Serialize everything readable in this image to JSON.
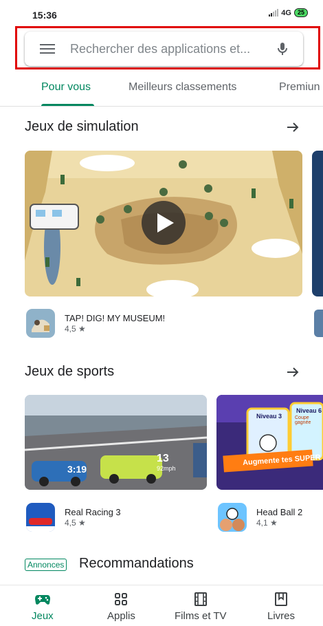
{
  "status_bar": {
    "time": "15:36",
    "network": "4G",
    "battery": "25"
  },
  "search": {
    "placeholder": "Rechercher des applications et..."
  },
  "tabs": [
    {
      "label": "Pour vous",
      "active": true
    },
    {
      "label": "Meilleurs classements",
      "active": false
    },
    {
      "label": "Premiun",
      "active": false
    }
  ],
  "sections": {
    "simulation": {
      "title": "Jeux de simulation",
      "app": {
        "name": "TAP! DIG! MY MUSEUM!",
        "rating": "4,5 ★"
      }
    },
    "sports": {
      "title": "Jeux de sports",
      "apps": [
        {
          "name": "Real Racing 3",
          "rating": "4,5 ★",
          "video_overlay": "3:19",
          "speed": "13",
          "speed_unit": "92mph"
        },
        {
          "name": "Head Ball 2",
          "rating": "4,1 ★",
          "banner": "Augmente tes SUPER",
          "card_left": "Niveau 3",
          "card_right": "Niveau 6",
          "card_sub": "Coupe gagnée"
        }
      ]
    },
    "recommendations": {
      "badge": "Annonces",
      "title": "Recommandations"
    }
  },
  "bottom_nav": [
    {
      "label": "Jeux",
      "icon": "gamepad-icon",
      "active": true
    },
    {
      "label": "Applis",
      "icon": "apps-grid-icon",
      "active": false
    },
    {
      "label": "Films et TV",
      "icon": "film-icon",
      "active": false
    },
    {
      "label": "Livres",
      "icon": "bookmark-icon",
      "active": false
    }
  ],
  "colors": {
    "accent": "#01875f",
    "highlight": "#e00000"
  }
}
